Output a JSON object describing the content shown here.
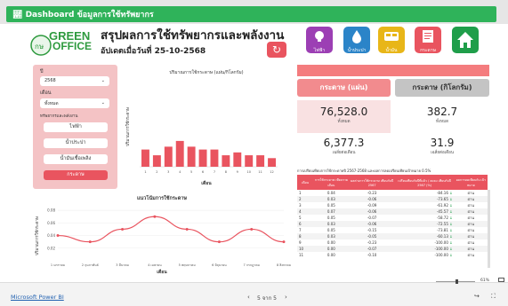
{
  "app": {
    "title": "Dashboard ข้อมูลการใช้ทรัพยากร",
    "footer_link": "Microsoft Power BI",
    "page_indicator": "5 จาก 5",
    "zoom": "61%"
  },
  "header": {
    "logo_green": "GREEN",
    "logo_office": "OFFICE",
    "title": "สรุปผลการใช้ทรัพยากรและพลังงาน",
    "updated": "อัปเดตเมื่อวันที่  25-10-2568"
  },
  "nav": [
    {
      "label": "ไฟฟ้า",
      "color": "#9c3fb4"
    },
    {
      "label": "น้ำประปา",
      "color": "#2b84c8"
    },
    {
      "label": "น้ำมัน",
      "color": "#e8b618"
    },
    {
      "label": "กระดาษ",
      "color": "#e9545f"
    },
    {
      "label": "",
      "color": "#1f9e4a"
    }
  ],
  "filters": {
    "year_label": "ปี",
    "year_value": "2568",
    "month_label": "เดือน",
    "month_value": "ทั้งหมด",
    "resource_label": "ทรัพยากรและพลังงาน",
    "buttons": [
      "ไฟฟ้า",
      "น้ำประปา",
      "น้ำมันเชื้อเพลิง",
      "กระดาษ"
    ]
  },
  "kpi": {
    "head_left": "กระดาษ (แผ่น)",
    "head_right": "กระดาษ (กิโลกรัม)",
    "total_left": "76,528.0",
    "total_right": "382.7",
    "total_sub": "ทั้งหมด",
    "avg_left": "6,377.3",
    "avg_right": "31.9",
    "avg_sub": "เฉลี่ยต่อเดือน"
  },
  "table": {
    "caption": "การเปรียบเทียบการใช้กระดาษปี 2567-2568 และผลการลดเปรียบเทียบเป้าหมาย 0.5%",
    "headers": [
      "เดือน",
      "การใช้กระดาษ เทียบรายเดือน",
      "ผลต่างการใช้กระดาษ เทียบกับปี 2567",
      "เปรียบเทียบกับปีที่แล้ว / ลดลง เทียบกับปี 2567 (%)",
      "ผลการลดเทียบกับ เป้าหมาย"
    ],
    "rows": [
      {
        "m": "1",
        "a": "0.04",
        "b": "-0.23",
        "c": "-84.16",
        "d": "ผ่าน"
      },
      {
        "m": "2",
        "a": "0.03",
        "b": "-0.06",
        "c": "-73.65",
        "d": "ผ่าน"
      },
      {
        "m": "3",
        "a": "0.05",
        "b": "-0.09",
        "c": "-61.92",
        "d": "ผ่าน"
      },
      {
        "m": "4",
        "a": "0.07",
        "b": "-0.06",
        "c": "-45.57",
        "d": "ผ่าน"
      },
      {
        "m": "5",
        "a": "0.05",
        "b": "-0.07",
        "c": "-58.72",
        "d": "ผ่าน"
      },
      {
        "m": "6",
        "a": "0.03",
        "b": "-0.06",
        "c": "-72.55",
        "d": "ผ่าน"
      },
      {
        "m": "7",
        "a": "0.05",
        "b": "-0.15",
        "c": "-73.81",
        "d": "ผ่าน"
      },
      {
        "m": "8",
        "a": "0.03",
        "b": "-0.05",
        "c": "-60.13",
        "d": "ผ่าน"
      },
      {
        "m": "9",
        "a": "0.00",
        "b": "-0.23",
        "c": "-100.00",
        "d": "ผ่าน"
      },
      {
        "m": "10",
        "a": "0.00",
        "b": "-0.07",
        "c": "-100.00",
        "d": "ผ่าน"
      },
      {
        "m": "11",
        "a": "0.00",
        "b": "-0.10",
        "c": "-100.00",
        "d": "ผ่าน"
      }
    ]
  },
  "chart_data": [
    {
      "type": "bar",
      "title": "ปริมาณการใช้กระดาษ (แผ่น/กิโลกรัม)",
      "xlabel": "เดือน",
      "ylabel": "ปริมาณการใช้กระดาษ",
      "color": "#e9545f",
      "categories": [
        "1",
        "2",
        "3",
        "4",
        "5",
        "6",
        "7",
        "8",
        "9",
        "10",
        "11",
        "12"
      ],
      "values": [
        6,
        4,
        7,
        9,
        7,
        6,
        6,
        4,
        5,
        4,
        4,
        3
      ],
      "ylim": [
        0,
        30
      ]
    },
    {
      "type": "line",
      "title": "แนวโน้มการใช้กระดาษ",
      "xlabel": "เดือน",
      "ylabel": "ปริมาณการใช้กระดาษ",
      "color": "#e9545f",
      "categories": [
        "1 มกราคม",
        "2 กุมภาพันธ์",
        "3 มีนาคม",
        "4 เมษายน",
        "5 พฤษภาคม",
        "6 มิถุนายน",
        "7 กรกฎาคม",
        "8 สิงหาคม"
      ],
      "values": [
        0.04,
        0.03,
        0.05,
        0.07,
        0.05,
        0.03,
        0.05,
        0.03
      ],
      "yticks": [
        "0.08",
        "0.06",
        "0.04",
        "0.02"
      ],
      "ylim": [
        0,
        0.09
      ]
    }
  ]
}
